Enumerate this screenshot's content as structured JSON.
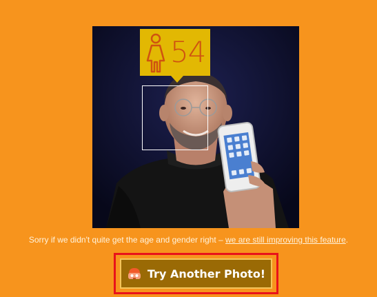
{
  "result": {
    "age": "54",
    "gender_icon": "female-figure-icon"
  },
  "photo": {
    "icon": "person-photo"
  },
  "disclaimer": {
    "text": "Sorry if we didn't quite get the age and gender right – ",
    "link_text": "we are still improving this feature",
    "suffix": "."
  },
  "button": {
    "label": "Try Another Photo!",
    "icon": "camera-robot-icon"
  },
  "colors": {
    "background": "#f7941d",
    "badge": "#e2b803",
    "age_text": "#cf5310",
    "button": "#9a6a05",
    "highlight": "#e8121b"
  }
}
